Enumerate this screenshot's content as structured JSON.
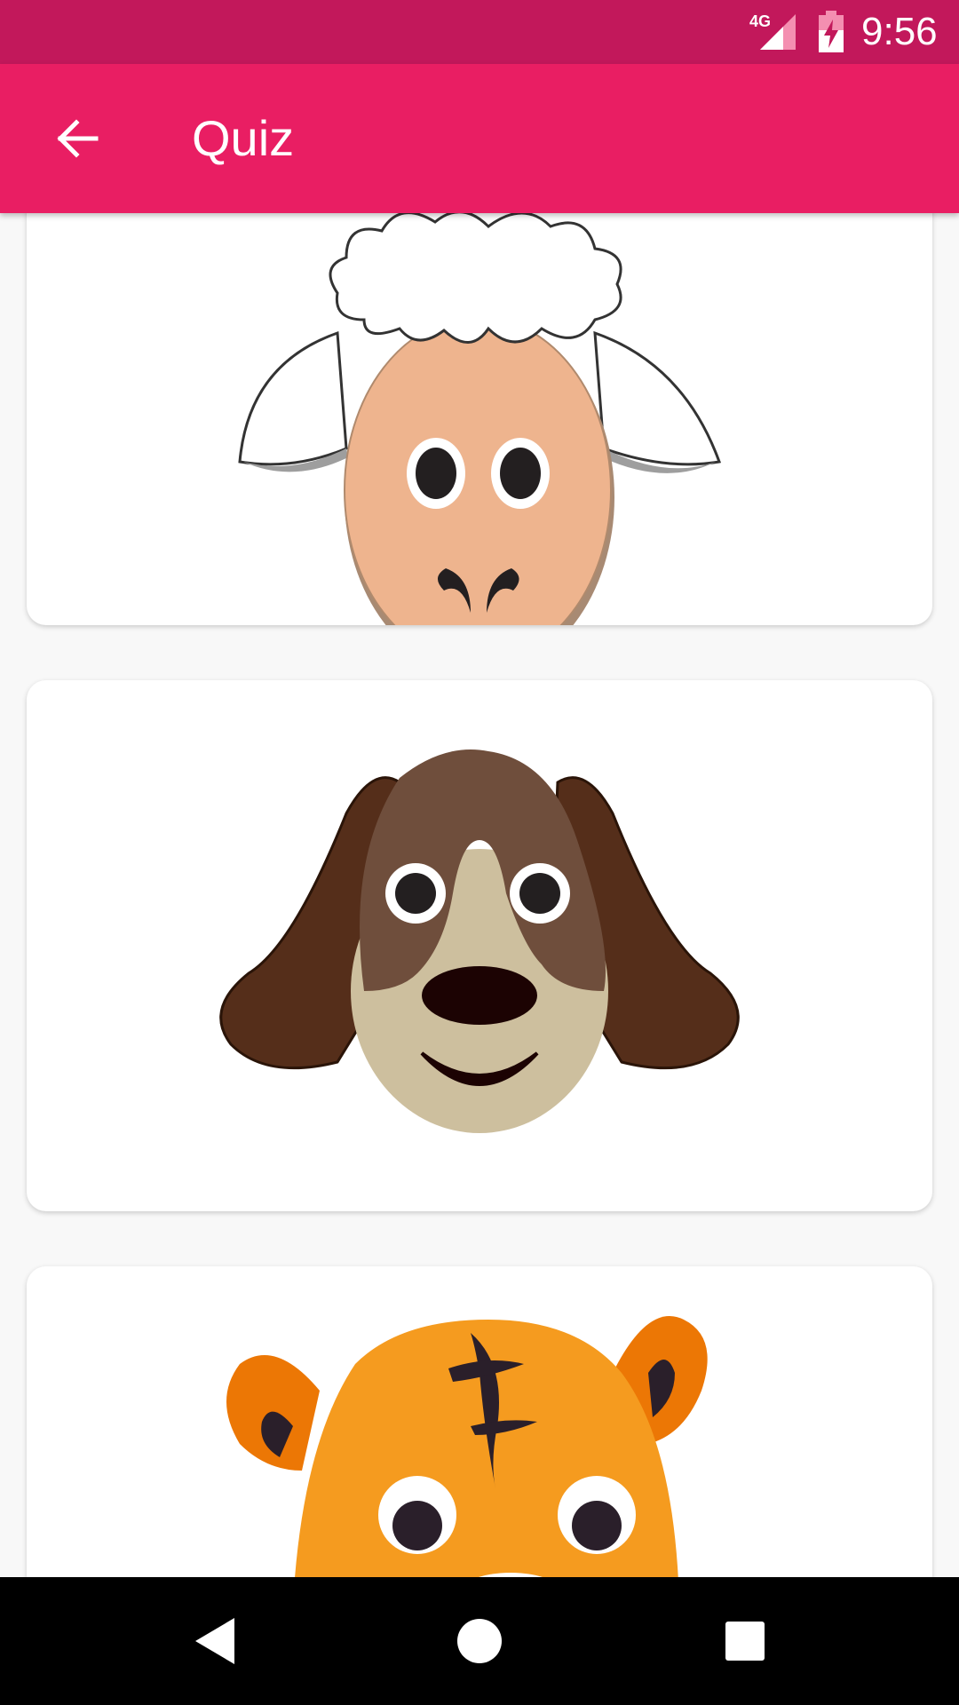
{
  "status_bar": {
    "network": "4G",
    "time": "9:56"
  },
  "app_bar": {
    "title": "Quiz"
  },
  "cards": [
    {
      "animal": "sheep"
    },
    {
      "animal": "dog"
    },
    {
      "animal": "tiger"
    }
  ],
  "colors": {
    "status_bar": "#c2185b",
    "app_bar": "#e91e63",
    "background": "#f8f8f8"
  }
}
